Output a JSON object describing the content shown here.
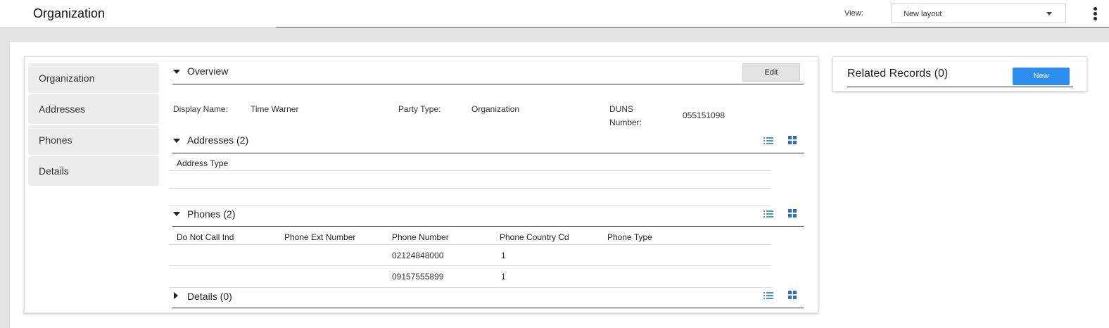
{
  "header": {
    "title": "Organization",
    "view_label": "View:",
    "view_selected": "New layout"
  },
  "nav": {
    "items": [
      {
        "label": "Organization"
      },
      {
        "label": "Addresses"
      },
      {
        "label": "Phones"
      },
      {
        "label": "Details"
      }
    ]
  },
  "overview": {
    "title": "Overview",
    "edit_label": "Edit",
    "fields": {
      "display_name_label": "Display Name:",
      "display_name_value": "Time Warner",
      "party_type_label": "Party Type:",
      "party_type_value": "Organization",
      "duns_label_line1": "DUNS",
      "duns_label_line2": "Number:",
      "duns_value": "055151098"
    }
  },
  "addresses": {
    "title": "Addresses (2)",
    "columns": [
      "Address Type"
    ]
  },
  "phones": {
    "title": "Phones (2)",
    "columns": [
      "Do Not Call Ind",
      "Phone Ext Number",
      "Phone Number",
      "Phone Country Cd",
      "Phone Type"
    ],
    "rows": [
      {
        "do_not_call": "",
        "ext": "",
        "number": "02124848000",
        "country_cd": "1",
        "type": ""
      },
      {
        "do_not_call": "",
        "ext": "",
        "number": "09157555899",
        "country_cd": "1",
        "type": ""
      }
    ]
  },
  "details": {
    "title": "Details (0)"
  },
  "related": {
    "title": "Related Records (0)",
    "new_label": "New"
  },
  "colors": {
    "accent": "#2b8ef0",
    "icon_blue": "#4a90e2"
  },
  "icons": [
    "caret-down-icon",
    "kebab-menu-icon",
    "list-view-icon",
    "grid-view-icon",
    "collapse-triangle-icon",
    "expand-triangle-icon"
  ]
}
